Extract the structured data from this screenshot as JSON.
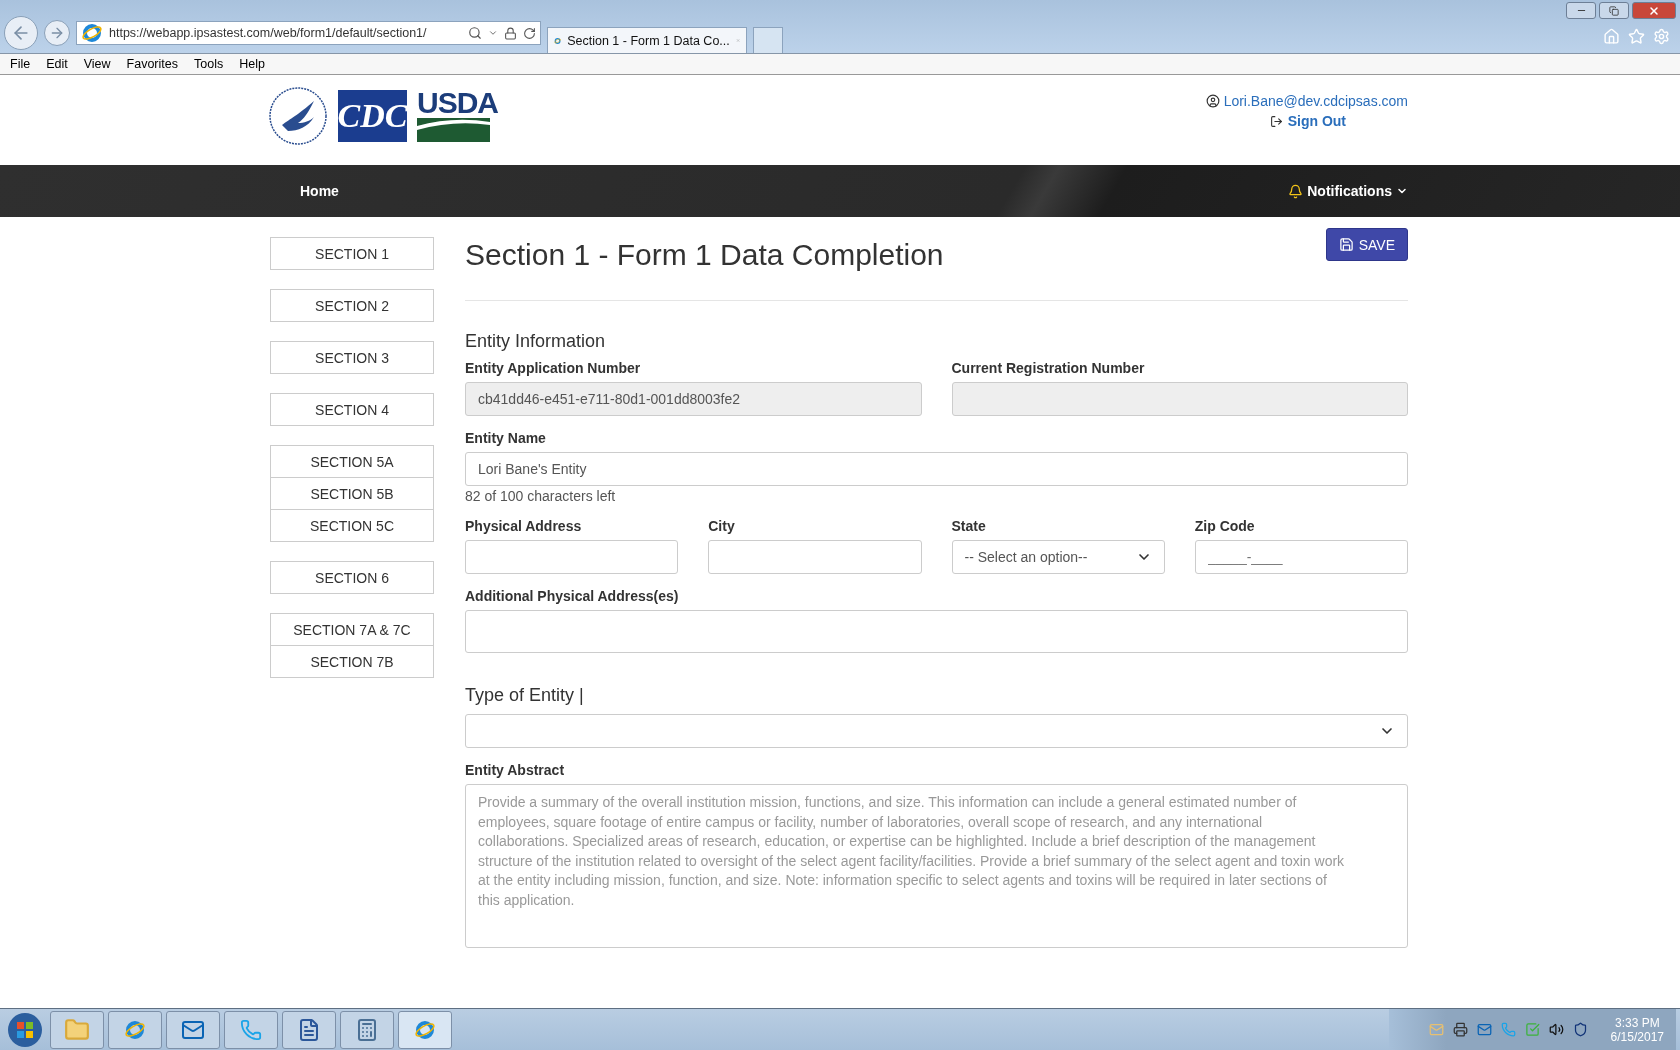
{
  "browser": {
    "url": "https://webapp.ipsastest.com/web/form1/default/section1/",
    "tab_title": "Section 1 - Form 1 Data Co...",
    "menu": [
      "File",
      "Edit",
      "View",
      "Favorites",
      "Tools",
      "Help"
    ]
  },
  "header": {
    "logos": [
      "CDC",
      "USDA"
    ],
    "user_email": "Lori.Bane@dev.cdcipsas.com",
    "sign_out": "Sign Out"
  },
  "nav": {
    "home": "Home",
    "notifications": "Notifications"
  },
  "sidebar": {
    "groups": [
      [
        "SECTION 1"
      ],
      [
        "SECTION 2"
      ],
      [
        "SECTION 3"
      ],
      [
        "SECTION 4"
      ],
      [
        "SECTION 5A",
        "SECTION 5B",
        "SECTION 5C"
      ],
      [
        "SECTION 6"
      ],
      [
        "SECTION 7A & 7C",
        "SECTION 7B"
      ]
    ]
  },
  "page": {
    "title": "Section 1 - Form 1 Data Completion",
    "save": "SAVE",
    "section_heading": "Entity Information",
    "registration": [
      {
        "label": "Entity Application Number",
        "kind": "text",
        "value": "cb41dd46-e451-e711-80d1-001dd8003fe2",
        "disabled": true,
        "large_label": false
      },
      {
        "label": "Current Registration Number",
        "kind": "text",
        "disabled": true,
        "large_label": false
      }
    ],
    "entity_name": {
      "label": "Entity Name",
      "kind": "text",
      "value": "Lori Bane's Entity",
      "disabled": false,
      "large_label": false,
      "helper": "82 of 100 characters left"
    },
    "address": [
      {
        "label": "Physical Address",
        "kind": "text",
        "disabled": false,
        "large_label": false
      },
      {
        "label": "City",
        "kind": "text",
        "disabled": false,
        "large_label": false
      },
      {
        "label": "State",
        "kind": "select",
        "value": "-- Select an option--",
        "disabled": false,
        "large_label": false
      },
      {
        "label": "Zip Code",
        "kind": "text",
        "placeholder": "_____-____",
        "disabled": false,
        "large_label": false
      }
    ],
    "additional_address": {
      "label": "Additional Physical Address(es)",
      "kind": "textarea",
      "disabled": false,
      "large_label": false
    },
    "entity_type": {
      "label": "Type of Entity |",
      "kind": "select",
      "disabled": false,
      "large_label": true
    },
    "abstract": {
      "label": "Entity Abstract",
      "kind": "abstract",
      "disabled": false,
      "large_label": false,
      "placeholder": "Provide a summary of the overall institution mission, functions, and size. This information can include a general estimated number of employees, square footage of entire campus or facility, number of laboratories, overall scope of research, and any international collaborations. Specialized areas of research, education, or expertise can be highlighted. Include a brief description of the management structure of the institution related to oversight of the select agent facility/facilities. Provide a brief summary of the select agent and toxin work at the entity including mission, function, and size. Note: information specific to select agents and toxins will be required in later sections of this application."
    }
  },
  "taskbar": {
    "time": "3:33 PM",
    "date": "6/15/2017"
  }
}
